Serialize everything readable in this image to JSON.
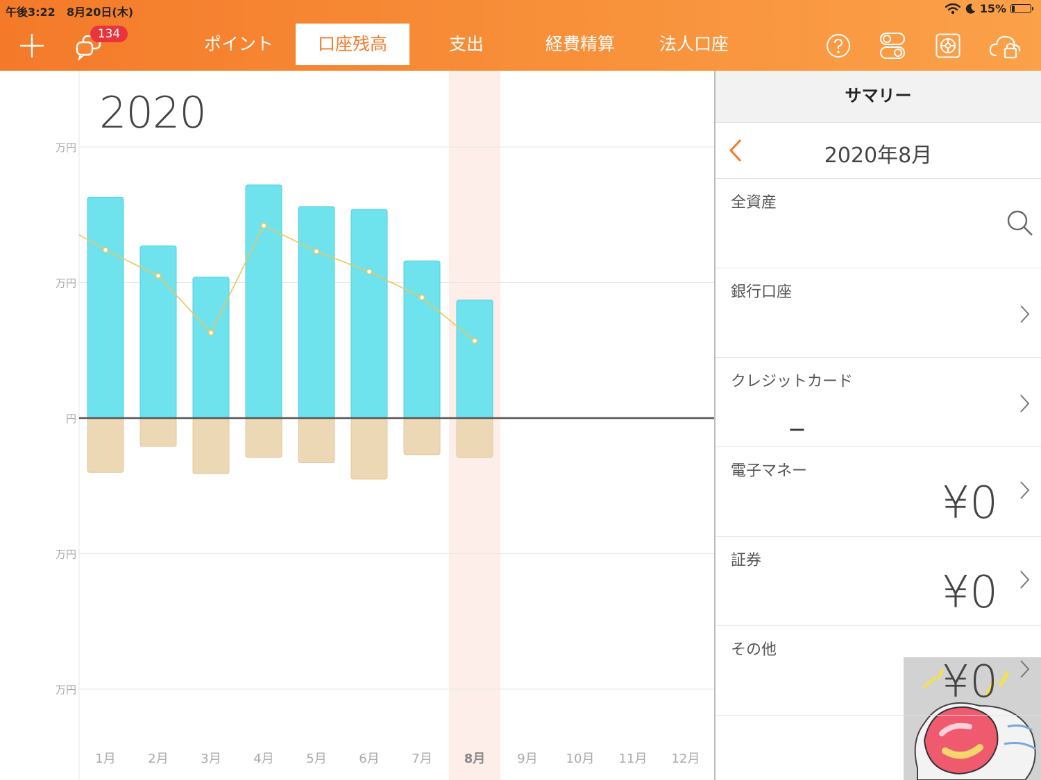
{
  "status_bar": {
    "time": "午後3:22",
    "date": "8月20日(木)",
    "battery_text": "15%",
    "battery_level": 0.15
  },
  "toolbar": {
    "badge_count": "134",
    "tabs": [
      {
        "label": "ポイント",
        "active": false
      },
      {
        "label": "口座残高",
        "active": true
      },
      {
        "label": "支出",
        "active": false
      },
      {
        "label": "経費精算",
        "active": false
      },
      {
        "label": "法人口座",
        "active": false
      }
    ],
    "accent_color": "#f47a2a"
  },
  "chart_data": {
    "type": "bar",
    "title": "2020",
    "categories": [
      "1月",
      "2月",
      "3月",
      "4月",
      "5月",
      "6月",
      "7月",
      "8月",
      "9月",
      "10月",
      "11月",
      "12月"
    ],
    "highlighted_category": "8月",
    "y_tick_labels": [
      "万円",
      "万円",
      "円",
      "万円",
      "万円"
    ],
    "ylim": [
      -2,
      2
    ],
    "series": [
      {
        "kind": "bar",
        "color": "#6ee3ee",
        "values": [
          1.63,
          1.27,
          1.04,
          1.72,
          1.56,
          1.54,
          1.16,
          0.87,
          null,
          null,
          null,
          null
        ]
      },
      {
        "kind": "bar",
        "color": "#edd8b6",
        "values": [
          -0.4,
          -0.21,
          -0.41,
          -0.29,
          -0.33,
          -0.45,
          -0.27,
          -0.29,
          null,
          null,
          null,
          null
        ]
      },
      {
        "kind": "line",
        "color": "#efc45a",
        "values": [
          1.24,
          1.05,
          0.63,
          1.42,
          1.23,
          1.08,
          0.89,
          0.57,
          null,
          null,
          null,
          null
        ]
      }
    ],
    "grid": true
  },
  "summary": {
    "header": "サマリー",
    "period": "2020年8月",
    "rows": [
      {
        "label": "全資産",
        "value": "",
        "icon": "search-icon"
      },
      {
        "label": "銀行口座",
        "value": "",
        "icon": "chevron-right-icon"
      },
      {
        "label": "クレジットカード",
        "value": "",
        "dash": "−",
        "icon": "chevron-right-icon"
      },
      {
        "label": "電子マネー",
        "value": "¥0",
        "icon": "chevron-right-icon"
      },
      {
        "label": "証券",
        "value": "¥0",
        "icon": "chevron-right-icon"
      },
      {
        "label": "その他",
        "value": "¥0",
        "icon": "chevron-right-icon"
      }
    ]
  }
}
